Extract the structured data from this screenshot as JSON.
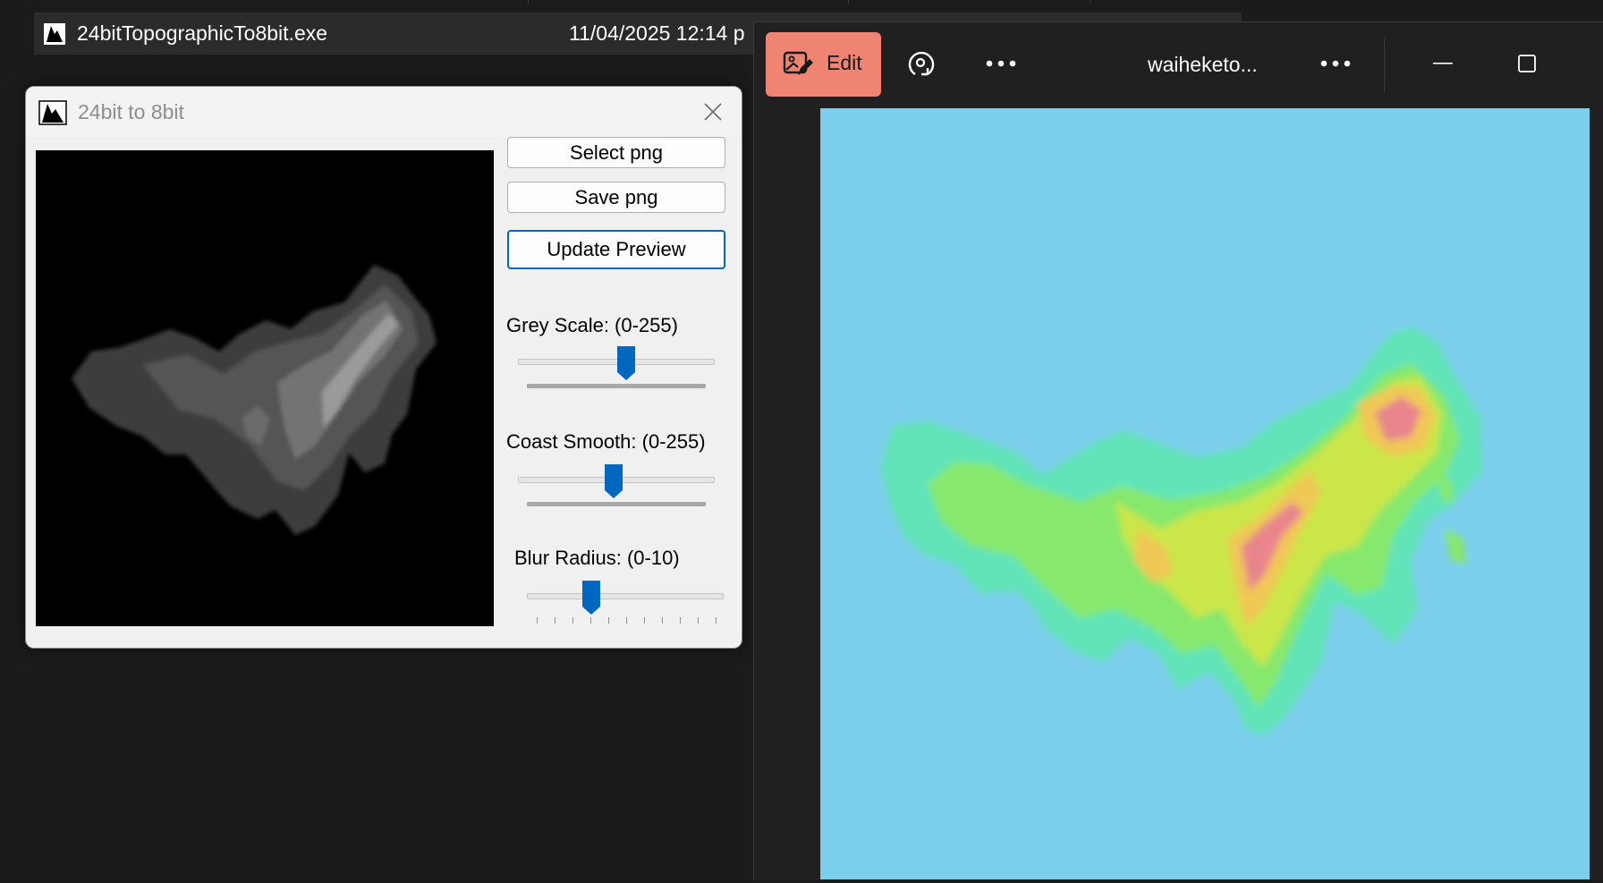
{
  "explorer": {
    "file_name": "24bitTopographicTo8bit.exe",
    "file_date": "11/04/2025 12:14 p"
  },
  "dialog": {
    "title": "24bit to 8bit",
    "buttons": {
      "select": "Select png",
      "save": "Save png",
      "update": "Update Preview"
    },
    "sliders": [
      {
        "label": "Grey Scale: (0-255)",
        "value_fraction": 0.55
      },
      {
        "label": "Coast Smooth: (0-255)",
        "value_fraction": 0.49
      },
      {
        "label": "Blur Radius: (0-10)",
        "value_fraction": 0.35
      }
    ]
  },
  "photos": {
    "edit_label": "Edit",
    "image_title": "waiheketo...",
    "accent_color": "#f08472",
    "water_color": "#7ccfec"
  }
}
